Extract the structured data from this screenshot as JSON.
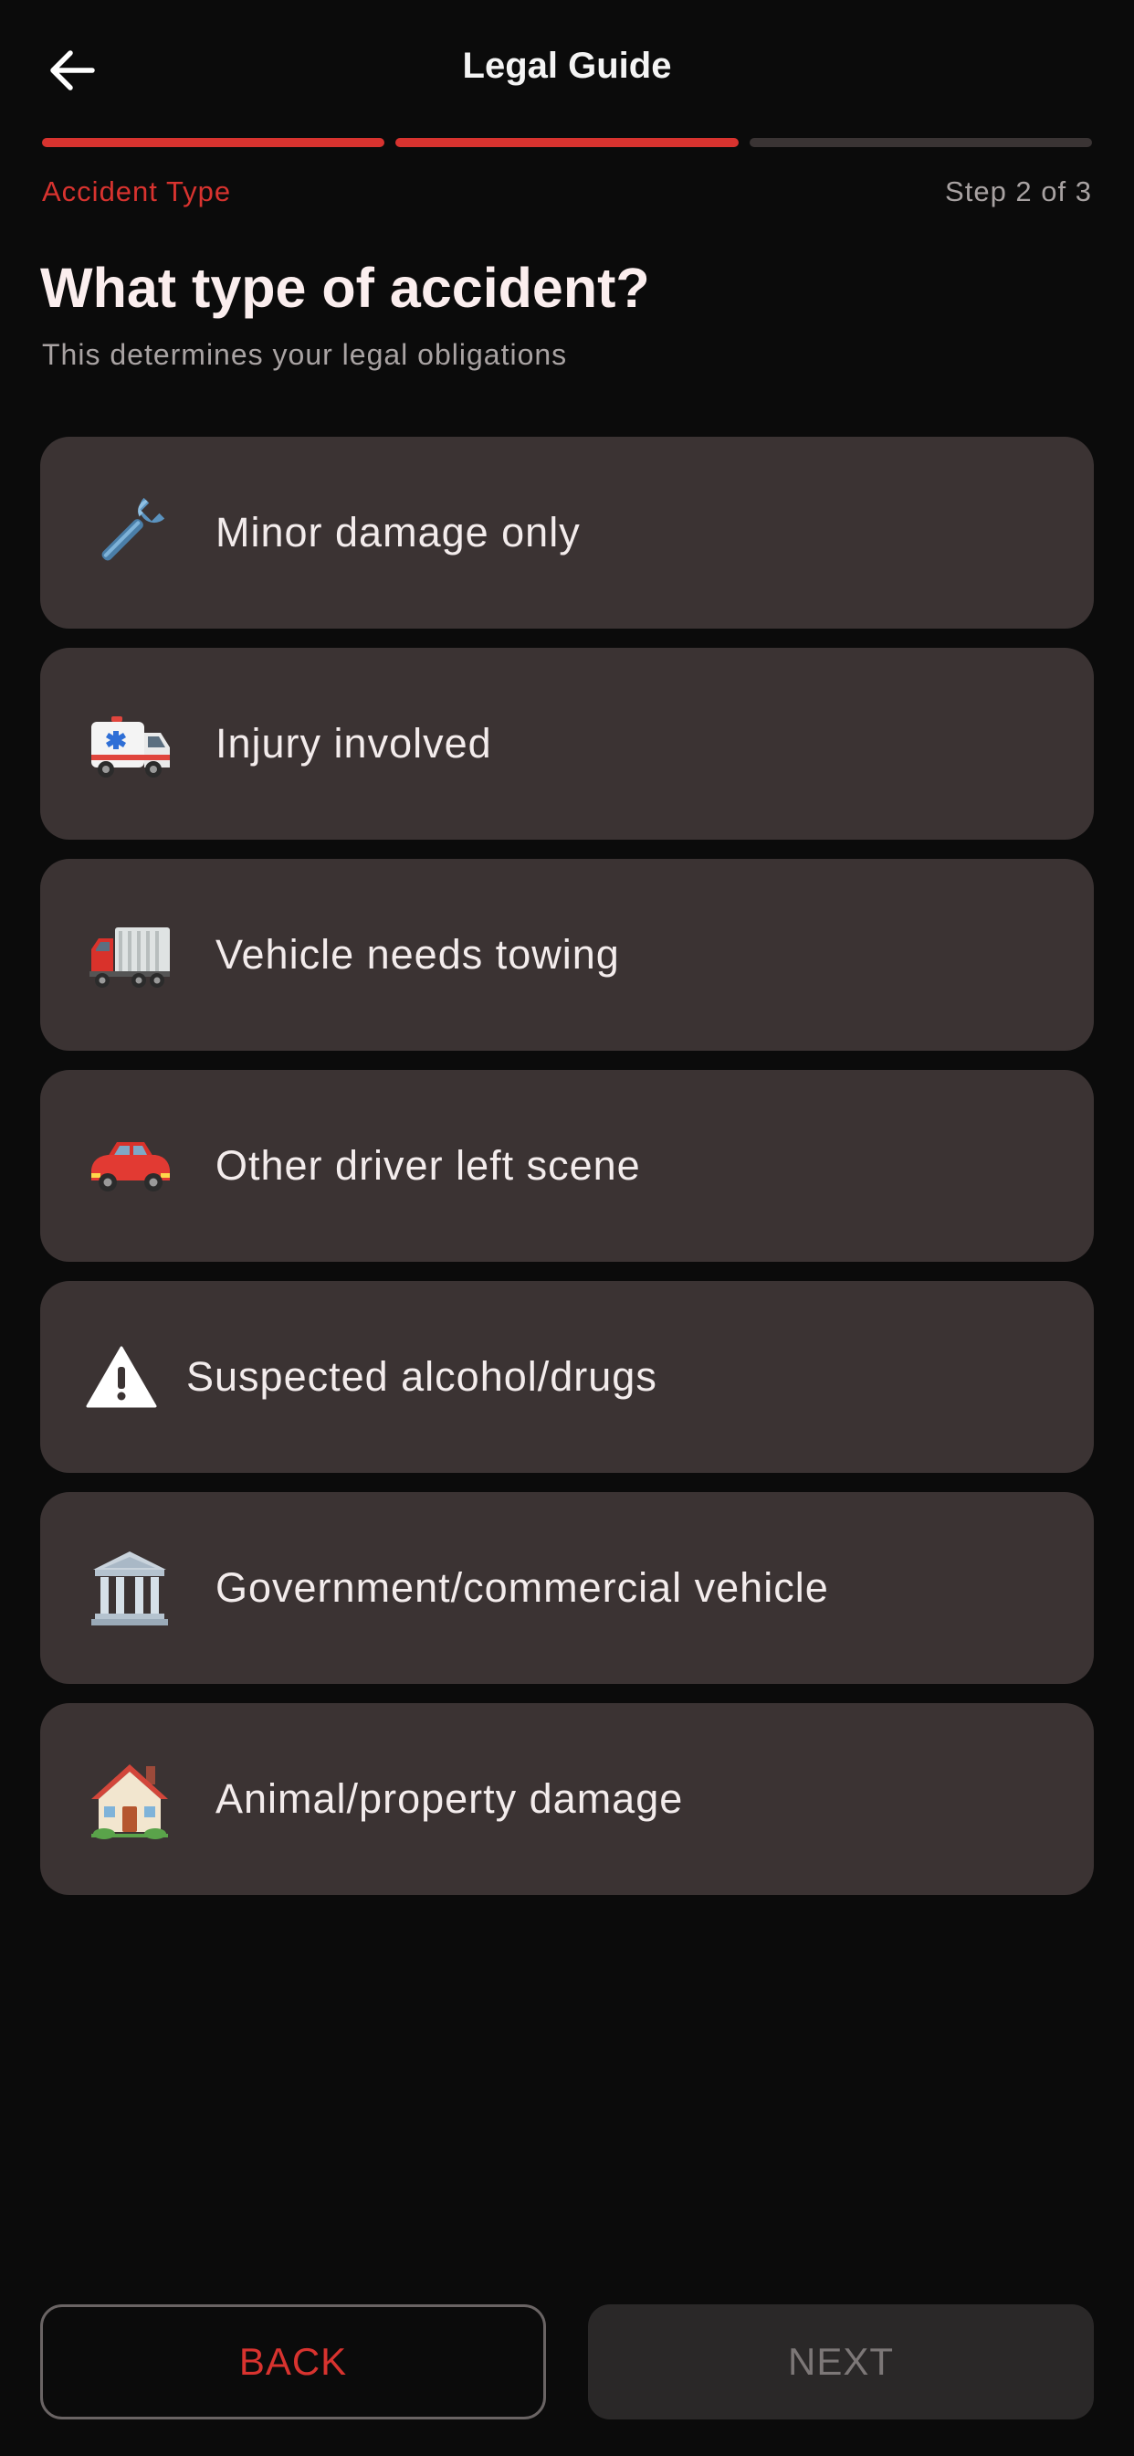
{
  "header": {
    "title": "Legal Guide",
    "back_icon": "arrow-left-icon"
  },
  "progress": {
    "current_step": 2,
    "total_steps": 3,
    "step_label": "Accident Type",
    "step_count_text": "Step 2 of 3",
    "accent_color": "#d8332f"
  },
  "question": {
    "title": "What type of accident?",
    "subtitle": "This determines your legal obligations"
  },
  "options": [
    {
      "label": "Minor damage only",
      "icon": "wrench-icon"
    },
    {
      "label": "Injury involved",
      "icon": "ambulance-icon"
    },
    {
      "label": "Vehicle needs towing",
      "icon": "truck-icon"
    },
    {
      "label": "Other driver left scene",
      "icon": "car-icon"
    },
    {
      "label": "Suspected alcohol/drugs",
      "icon": "warning-icon"
    },
    {
      "label": "Government/commercial vehicle",
      "icon": "government-building-icon"
    },
    {
      "label": "Animal/property damage",
      "icon": "house-icon"
    }
  ],
  "footer": {
    "back_label": "BACK",
    "next_label": "NEXT"
  }
}
